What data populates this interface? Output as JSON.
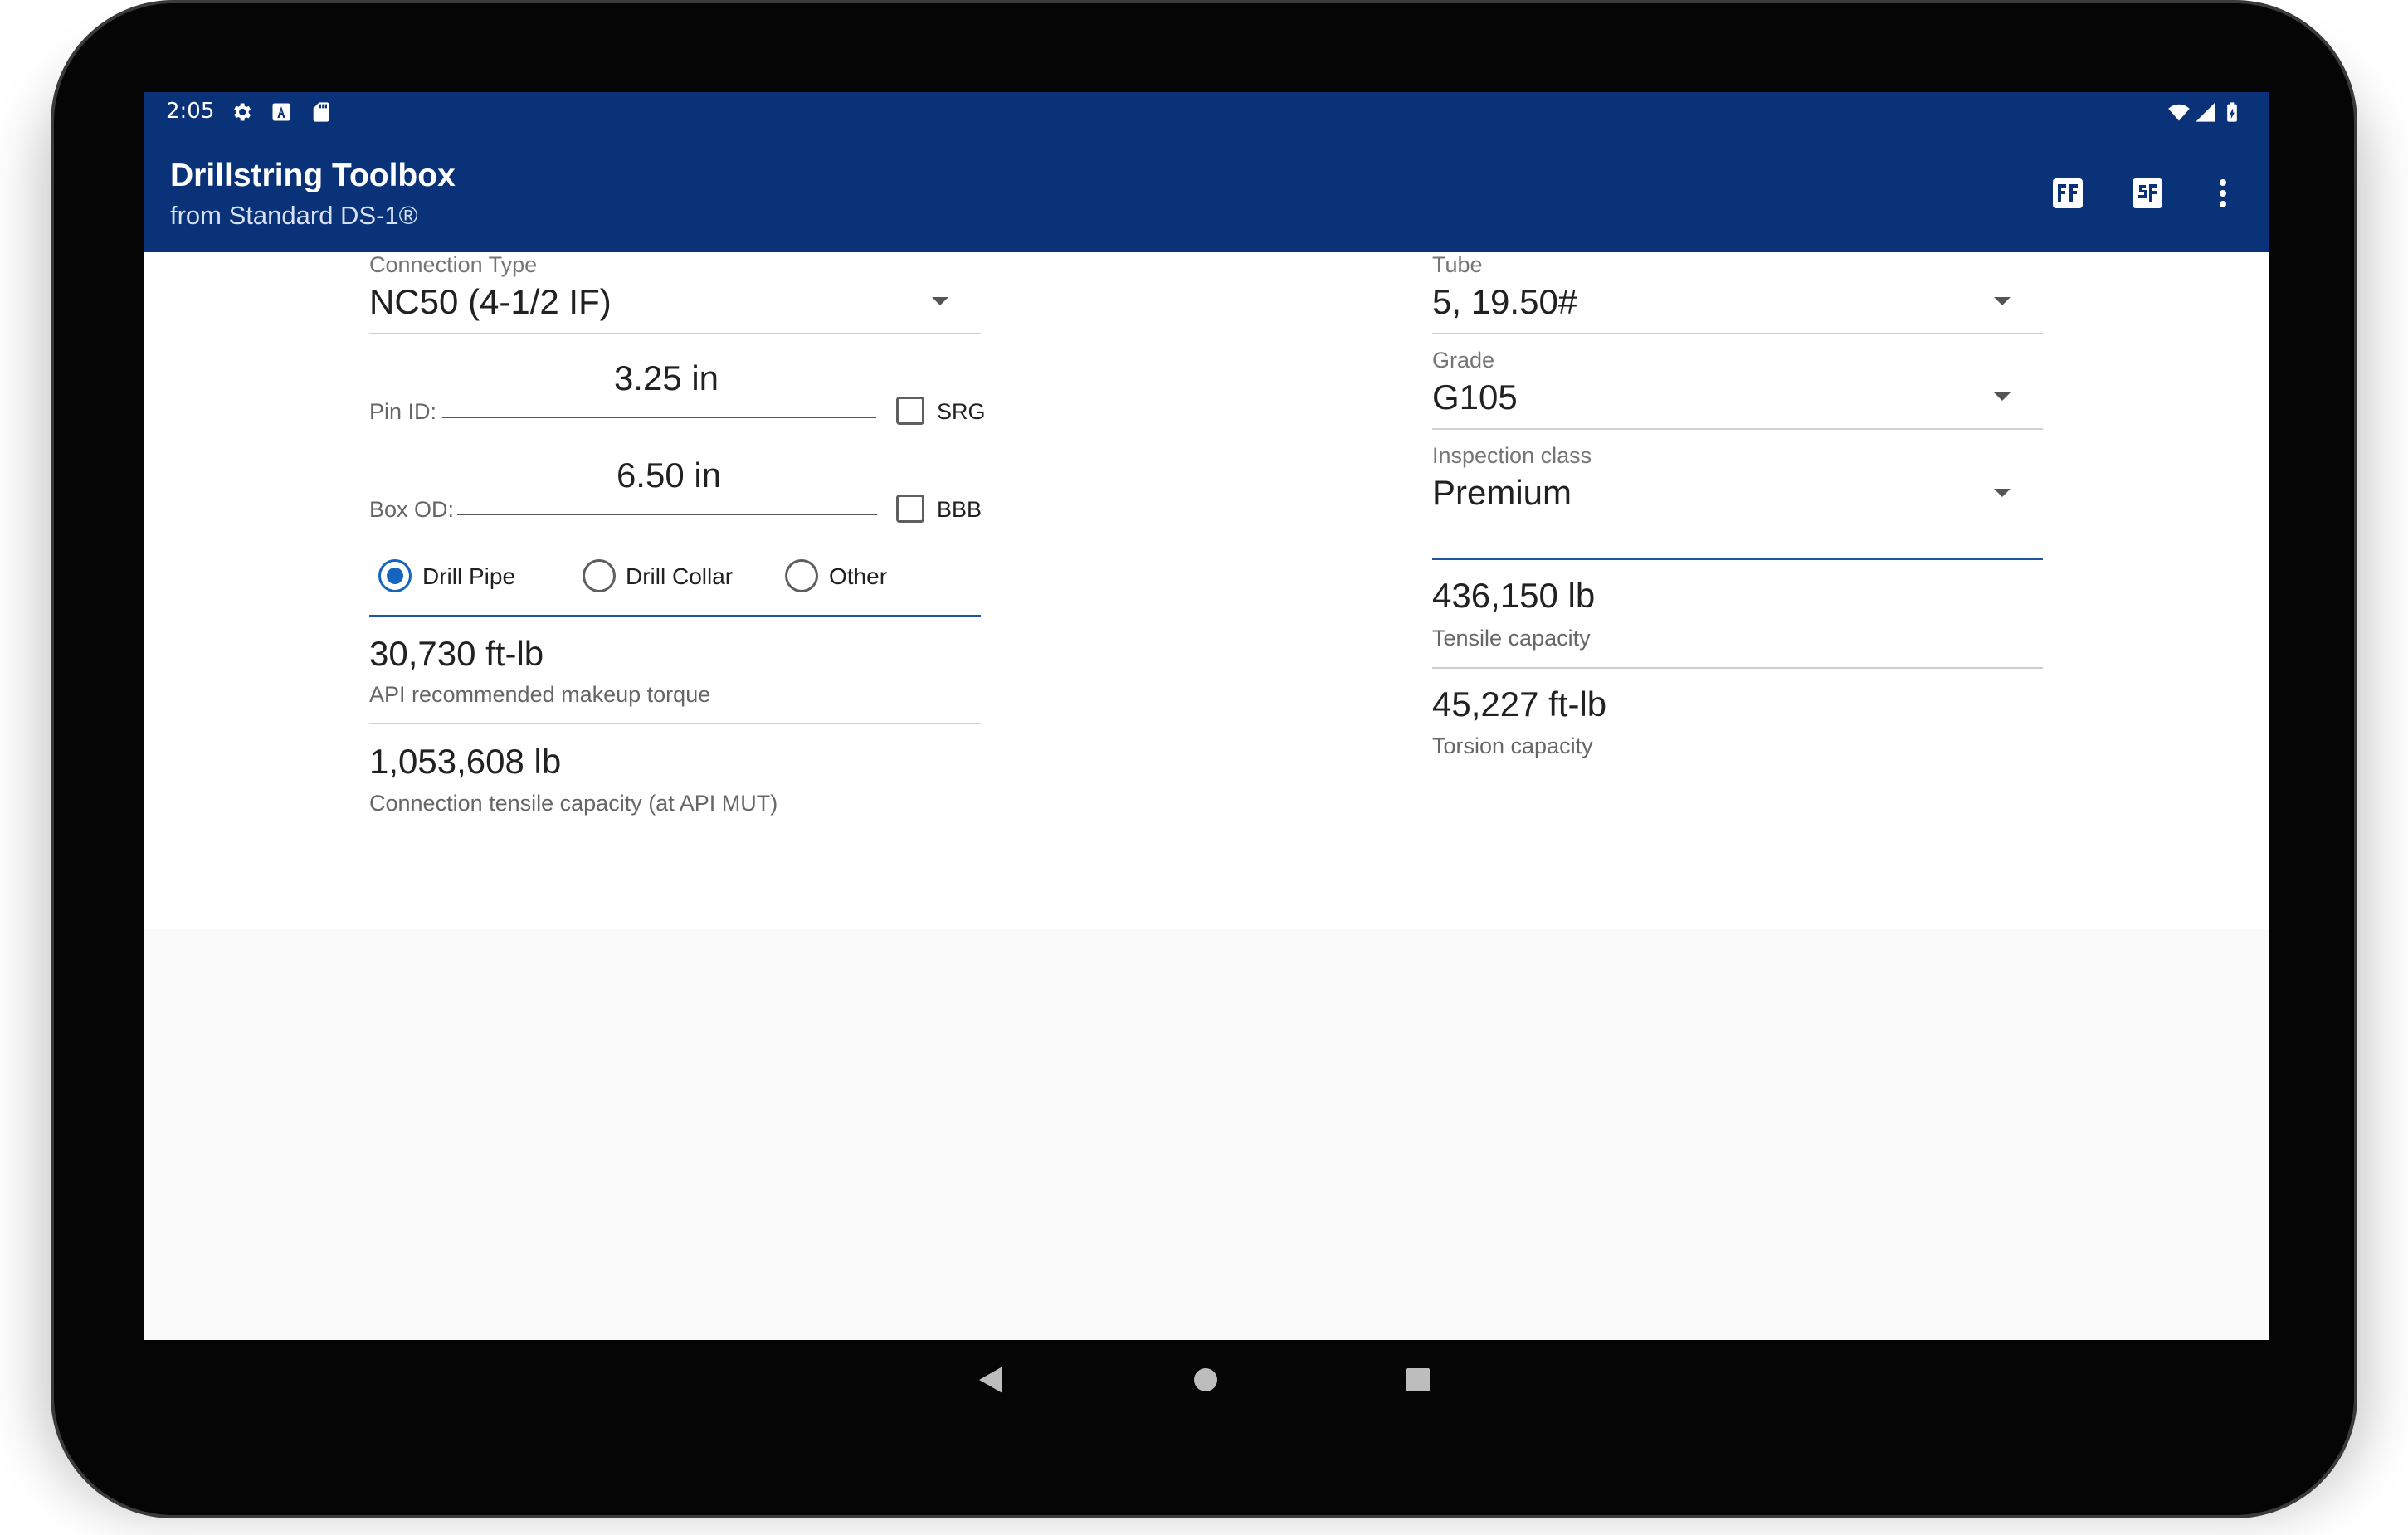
{
  "status_bar": {
    "time": "2:05",
    "left_icons": [
      "gear-icon",
      "a-icon",
      "sd-card-icon"
    ],
    "right_icons": [
      "wifi-icon",
      "signal-icon",
      "battery-icon"
    ]
  },
  "app_bar": {
    "title": "Drillstring Toolbox",
    "subtitle": "from Standard DS-1®",
    "actions": [
      "ff-icon",
      "sf-icon",
      "overflow-menu-icon"
    ],
    "color": "#0a3278"
  },
  "connection": {
    "type_label": "Connection Type",
    "type_value": "NC50 (4-1/2 IF)",
    "pin_id_label": "Pin ID:",
    "pin_id_value": "3.25 in",
    "srg_label": "SRG",
    "srg_checked": false,
    "box_od_label": "Box OD:",
    "box_od_value": "6.50 in",
    "bbb_label": "BBB",
    "bbb_checked": false,
    "pipe_types": [
      "Drill Pipe",
      "Drill Collar",
      "Other"
    ],
    "selected_pipe_type": "Drill Pipe",
    "makeup_torque_value": "30,730 ft-lb",
    "makeup_torque_label": "API recommended makeup torque",
    "tensile_value": "1,053,608 lb",
    "tensile_label": "Connection tensile capacity (at API MUT)"
  },
  "tube": {
    "tube_label": "Tube",
    "tube_value": "5, 19.50#",
    "grade_label": "Grade",
    "grade_value": "G105",
    "inspection_label": "Inspection class",
    "inspection_value": "Premium",
    "tensile_value": "436,150 lb",
    "tensile_label": "Tensile capacity",
    "torsion_value": "45,227 ft-lb",
    "torsion_label": "Torsion capacity"
  },
  "nav_bar": {
    "buttons": [
      "back-icon",
      "home-icon",
      "recents-icon"
    ]
  },
  "accent_color": "#1565c0"
}
